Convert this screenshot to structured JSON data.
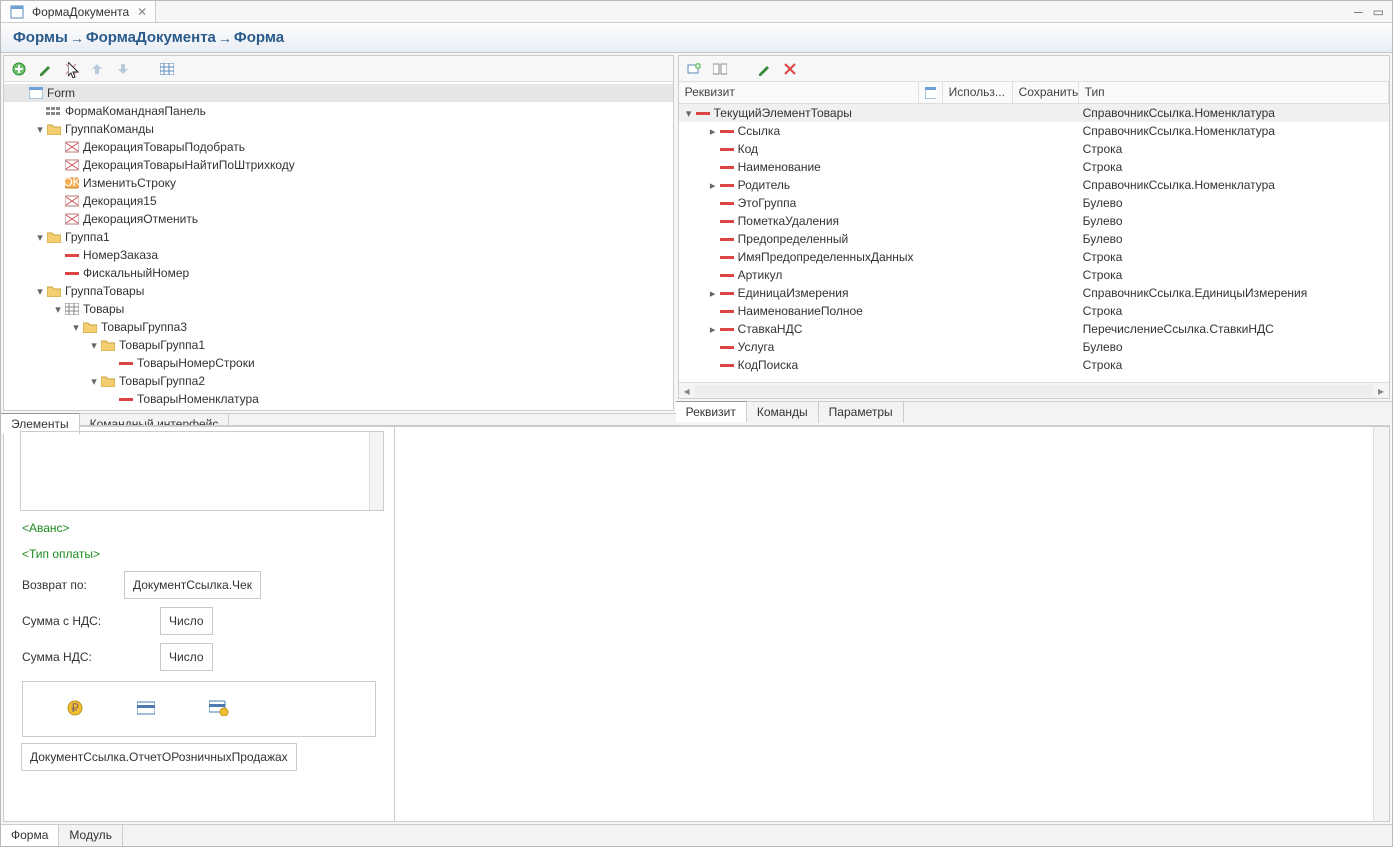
{
  "tab_title": "ФормаДокумента",
  "breadcrumb": [
    "Формы",
    "ФормаДокумента",
    "Форма"
  ],
  "left_tree": [
    {
      "d": 0,
      "tw": "",
      "ic": "form",
      "t": "Form",
      "sel": true
    },
    {
      "d": 1,
      "tw": "",
      "ic": "cmd",
      "t": "ФормаКоманднаяПанель"
    },
    {
      "d": 1,
      "tw": "▾",
      "ic": "folder",
      "t": "ГруппаКоманды"
    },
    {
      "d": 2,
      "tw": "",
      "ic": "deco",
      "t": "ДекорацияТоварыПодобрать"
    },
    {
      "d": 2,
      "tw": "",
      "ic": "deco",
      "t": "ДекорацияТоварыНайтиПоШтрихкоду"
    },
    {
      "d": 2,
      "tw": "",
      "ic": "btn",
      "t": "ИзменитьСтроку"
    },
    {
      "d": 2,
      "tw": "",
      "ic": "deco",
      "t": "Декорация15"
    },
    {
      "d": 2,
      "tw": "",
      "ic": "deco",
      "t": "ДекорацияОтменить"
    },
    {
      "d": 1,
      "tw": "▾",
      "ic": "folder",
      "t": "Группа1"
    },
    {
      "d": 2,
      "tw": "",
      "ic": "fld",
      "t": "НомерЗаказа"
    },
    {
      "d": 2,
      "tw": "",
      "ic": "fld",
      "t": "ФискальныйНомер"
    },
    {
      "d": 1,
      "tw": "▾",
      "ic": "folder",
      "t": "ГруппаТовары"
    },
    {
      "d": 2,
      "tw": "▾",
      "ic": "tbl",
      "t": "Товары"
    },
    {
      "d": 3,
      "tw": "▾",
      "ic": "folder",
      "t": "ТоварыГруппа3"
    },
    {
      "d": 4,
      "tw": "▾",
      "ic": "folder",
      "t": "ТоварыГруппа1"
    },
    {
      "d": 5,
      "tw": "",
      "ic": "fld",
      "t": "ТоварыНомерСтроки"
    },
    {
      "d": 4,
      "tw": "▾",
      "ic": "folder",
      "t": "ТоварыГруппа2"
    },
    {
      "d": 5,
      "tw": "",
      "ic": "fld",
      "t": "ТоварыНоменклатура"
    }
  ],
  "left_tabs": [
    "Элементы",
    "Командный интерфейс"
  ],
  "left_tab_active": 0,
  "grid_head": {
    "req": "Реквизит",
    "use": "Использ...",
    "save": "Сохранить",
    "type": "Тип"
  },
  "grid_rows": [
    {
      "d": 0,
      "tw": "▾",
      "ic": "fld",
      "t": "ТекущийЭлементТовары",
      "type": "СправочникСсылка.Номенклатура",
      "sel": true
    },
    {
      "d": 1,
      "tw": "▸",
      "ic": "fld",
      "t": "Ссылка",
      "type": "СправочникСсылка.Номенклатура"
    },
    {
      "d": 1,
      "tw": "",
      "ic": "fld",
      "t": "Код",
      "type": "Строка"
    },
    {
      "d": 1,
      "tw": "",
      "ic": "fld",
      "t": "Наименование",
      "type": "Строка"
    },
    {
      "d": 1,
      "tw": "▸",
      "ic": "fld",
      "t": "Родитель",
      "type": "СправочникСсылка.Номенклатура"
    },
    {
      "d": 1,
      "tw": "",
      "ic": "fld",
      "t": "ЭтоГруппа",
      "type": "Булево"
    },
    {
      "d": 1,
      "tw": "",
      "ic": "fld",
      "t": "ПометкаУдаления",
      "type": "Булево"
    },
    {
      "d": 1,
      "tw": "",
      "ic": "fld",
      "t": "Предопределенный",
      "type": "Булево"
    },
    {
      "d": 1,
      "tw": "",
      "ic": "fld",
      "t": "ИмяПредопределенныхДанных",
      "type": "Строка"
    },
    {
      "d": 1,
      "tw": "",
      "ic": "fld",
      "t": "Артикул",
      "type": "Строка"
    },
    {
      "d": 1,
      "tw": "▸",
      "ic": "fld",
      "t": "ЕдиницаИзмерения",
      "type": "СправочникСсылка.ЕдиницыИзмерения"
    },
    {
      "d": 1,
      "tw": "",
      "ic": "fld",
      "t": "НаименованиеПолное",
      "type": "Строка"
    },
    {
      "d": 1,
      "tw": "▸",
      "ic": "fld",
      "t": "СтавкаНДС",
      "type": "ПеречислениеСсылка.СтавкиНДС"
    },
    {
      "d": 1,
      "tw": "",
      "ic": "fld",
      "t": "Услуга",
      "type": "Булево"
    },
    {
      "d": 1,
      "tw": "",
      "ic": "fld",
      "t": "КодПоиска",
      "type": "Строка"
    }
  ],
  "right_tabs": [
    "Реквизит",
    "Команды",
    "Параметры"
  ],
  "right_tab_active": 0,
  "preview": {
    "avance": "<Аванс>",
    "tipoplaty": "<Тип оплаты>",
    "return_label": "Возврат по:",
    "return_value": "ДокументСсылка.Чек",
    "sum_nds_label": "Сумма с НДС:",
    "sum_nds_value": "Число",
    "summands_label": "Сумма НДС:",
    "summands_value": "Число",
    "bottom_ref": "ДокументСсылка.ОтчетОРозничныхПродажах"
  },
  "footer_tabs": [
    "Форма",
    "Модуль"
  ],
  "footer_tab_active": 0
}
